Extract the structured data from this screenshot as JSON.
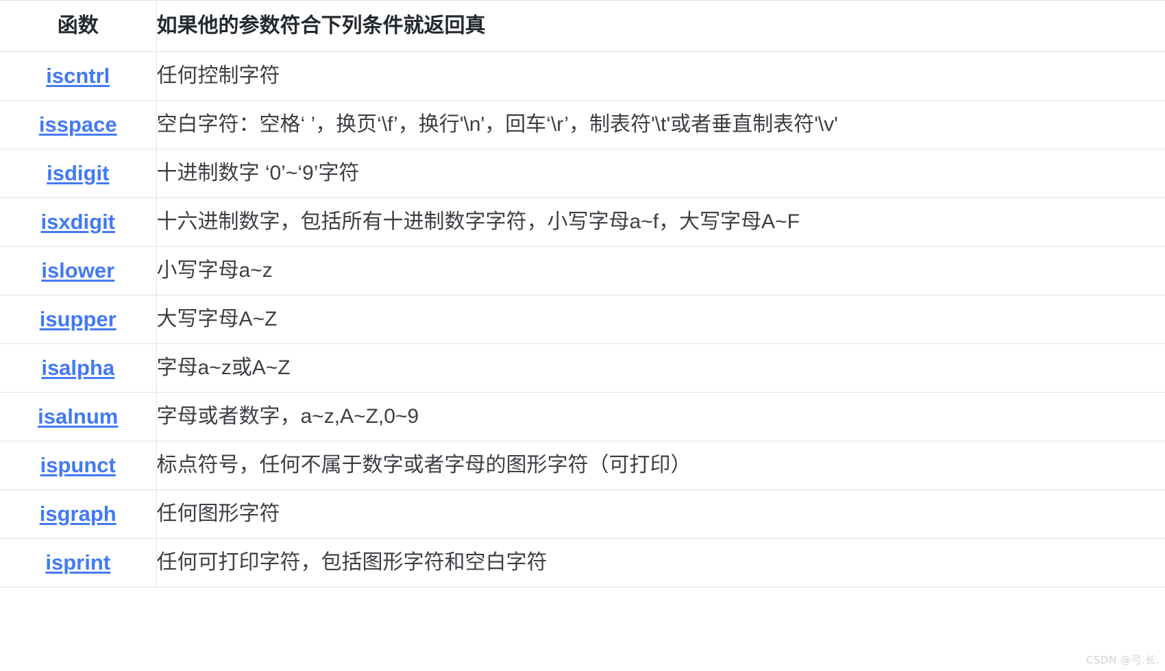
{
  "table": {
    "headers": {
      "function_column": "函数",
      "description_column": "如果他的参数符合下列条件就返回真"
    },
    "rows": [
      {
        "function": "iscntrl",
        "description": "任何控制字符"
      },
      {
        "function": "isspace",
        "description": "空白字符：空格‘ ’，换页‘\\f’，换行'\\n'，回车‘\\r’，制表符'\\t'或者垂直制表符'\\v'"
      },
      {
        "function": "isdigit",
        "description": "十进制数字 ‘0’~‘9’字符"
      },
      {
        "function": "isxdigit",
        "description": "十六进制数字，包括所有十进制数字字符，小写字母a~f，大写字母A~F"
      },
      {
        "function": "islower",
        "description": "小写字母a~z"
      },
      {
        "function": "isupper",
        "description": "大写字母A~Z"
      },
      {
        "function": "isalpha",
        "description": "字母a~z或A~Z"
      },
      {
        "function": "isalnum",
        "description": "字母或者数字，a~z,A~Z,0~9"
      },
      {
        "function": "ispunct",
        "description": "标点符号，任何不属于数字或者字母的图形字符（可打印）"
      },
      {
        "function": "isgraph",
        "description": "任何图形字符"
      },
      {
        "function": "isprint",
        "description": "任何可打印字符，包括图形字符和空白字符"
      }
    ]
  },
  "watermark": {
    "text": "CSDN @弓.长."
  },
  "colors": {
    "link": "#4279f4",
    "border": "#dfe2e5",
    "text": "#3b3f44",
    "header_text": "#24292e",
    "watermark": "#cfd2d6"
  }
}
